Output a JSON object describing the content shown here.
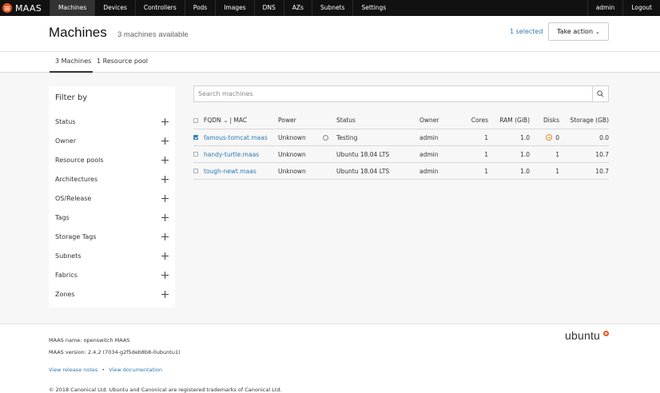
{
  "nav": {
    "brand": "MAAS",
    "items": [
      "Machines",
      "Devices",
      "Controllers",
      "Pods",
      "Images",
      "DNS",
      "AZs",
      "Subnets",
      "Settings"
    ],
    "right": [
      "admin",
      "Logout"
    ]
  },
  "header": {
    "title": "Machines",
    "subtitle": "3 machines available",
    "selected": "1 selected",
    "action_label": "Take action"
  },
  "tabs": [
    "3 Machines",
    "1 Resource pool"
  ],
  "filter": {
    "title": "Filter by",
    "items": [
      "Status",
      "Owner",
      "Resource pools",
      "Architectures",
      "OS/Release",
      "Tags",
      "Storage Tags",
      "Subnets",
      "Fabrics",
      "Zones"
    ]
  },
  "search": {
    "placeholder": "Search machines"
  },
  "table": {
    "headers": {
      "fqdn": "FQDN",
      "mac": "| MAC",
      "power": "Power",
      "status": "Status",
      "owner": "Owner",
      "cores": "Cores",
      "ram": "RAM (GiB)",
      "disks": "Disks",
      "storage": "Storage (GB)"
    },
    "rows": [
      {
        "fqdn": "famous-tomcat.maas",
        "power": "Unknown",
        "status": "Testing",
        "owner": "admin",
        "cores": "1",
        "ram": "1.0",
        "disks": "0",
        "storage": "0.0",
        "checked": true
      },
      {
        "fqdn": "handy-turtle.maas",
        "power": "Unknown",
        "status": "Ubuntu 18.04 LTS",
        "owner": "admin",
        "cores": "1",
        "ram": "1.0",
        "disks": "1",
        "storage": "10.7",
        "checked": false
      },
      {
        "fqdn": "tough-newt.maas",
        "power": "Unknown",
        "status": "Ubuntu 18.04 LTS",
        "owner": "admin",
        "cores": "1",
        "ram": "1.0",
        "disks": "1",
        "storage": "10.7",
        "checked": false
      }
    ]
  },
  "footer": {
    "name_label": "MAAS name:",
    "name_value": "openswitch MAAS",
    "version_label": "MAAS version:",
    "version_value": "2.4.2 (7034-g2f5deb8b8-0ubuntu1)",
    "link_release": "View release notes",
    "separator": "•",
    "link_docs": "View documentation",
    "copyright": "© 2018 Canonical Ltd. Ubuntu and Canonical are registered trademarks of Canonical Ltd.",
    "logo": "ubuntu"
  },
  "colors": {
    "accent": "#e95420",
    "link": "#2e7bb4",
    "nav_bg": "#111111"
  }
}
